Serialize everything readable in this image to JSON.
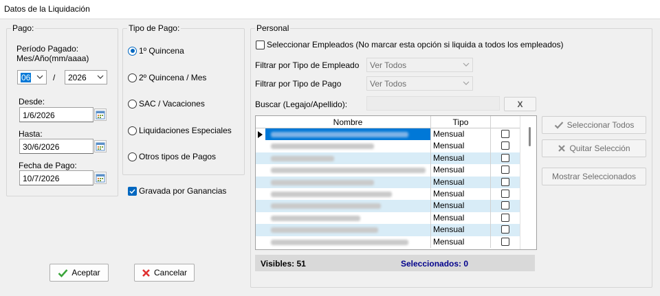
{
  "window": {
    "title": "Datos de la Liquidación"
  },
  "pago": {
    "legend": "Pago:",
    "periodo_label1": "Período Pagado:",
    "periodo_label2": "Mes/Año(mm/aaaa)",
    "mes": "06",
    "separator": "/",
    "anio": "2026",
    "desde_label": "Desde:",
    "desde": "1/6/2026",
    "hasta_label": "Hasta:",
    "hasta": "30/6/2026",
    "fecha_label": "Fecha de Pago:",
    "fecha": "10/7/2026"
  },
  "tipo_pago": {
    "legend": "Tipo de Pago:",
    "options": [
      {
        "label": "1º Quincena",
        "selected": true
      },
      {
        "label": "2º Quincena / Mes",
        "selected": false
      },
      {
        "label": "SAC / Vacaciones",
        "selected": false
      },
      {
        "label": "Liquidaciones Especiales",
        "selected": false
      },
      {
        "label": "Otros tipos de Pagos",
        "selected": false
      }
    ]
  },
  "gravada": {
    "label": "Gravada por Ganancias",
    "checked": true
  },
  "personal": {
    "legend": "Personal",
    "select_label": "Seleccionar Empleados (No marcar esta opción si liquida a todos los empleados)",
    "filtro_empleado_label": "Filtrar por Tipo de Empleado",
    "filtro_empleado_value": "Ver Todos",
    "filtro_pago_label": "Filtrar por Tipo de Pago",
    "filtro_pago_value": "Ver Todos",
    "buscar_label": "Buscar (Legajo/Apellido):",
    "clear_label": "X",
    "grid": {
      "col_nombre": "Nombre",
      "col_tipo": "Tipo",
      "rows": [
        {
          "tipo": "Mensual",
          "selected": true
        },
        {
          "tipo": "Mensual",
          "selected": false
        },
        {
          "tipo": "Mensual",
          "selected": false
        },
        {
          "tipo": "Mensual",
          "selected": false
        },
        {
          "tipo": "Mensual",
          "selected": false
        },
        {
          "tipo": "Mensual",
          "selected": false
        },
        {
          "tipo": "Mensual",
          "selected": false
        },
        {
          "tipo": "Mensual",
          "selected": false
        },
        {
          "tipo": "Mensual",
          "selected": false
        },
        {
          "tipo": "Mensual",
          "selected": false
        }
      ]
    },
    "visibles": "Visibles: 51",
    "seleccionados": "Seleccionados: 0",
    "btn_sel_todos": "Seleccionar Todos",
    "btn_quitar": "Quitar Selección",
    "btn_mostrar": "Mostrar Seleccionados"
  },
  "buttons": {
    "aceptar": "Aceptar",
    "cancelar": "Cancelar"
  },
  "colors": {
    "accent": "#0067c0",
    "row_alt": "#d8ecf7",
    "row_selected": "#0078d7",
    "status_blue": "#00008b"
  }
}
